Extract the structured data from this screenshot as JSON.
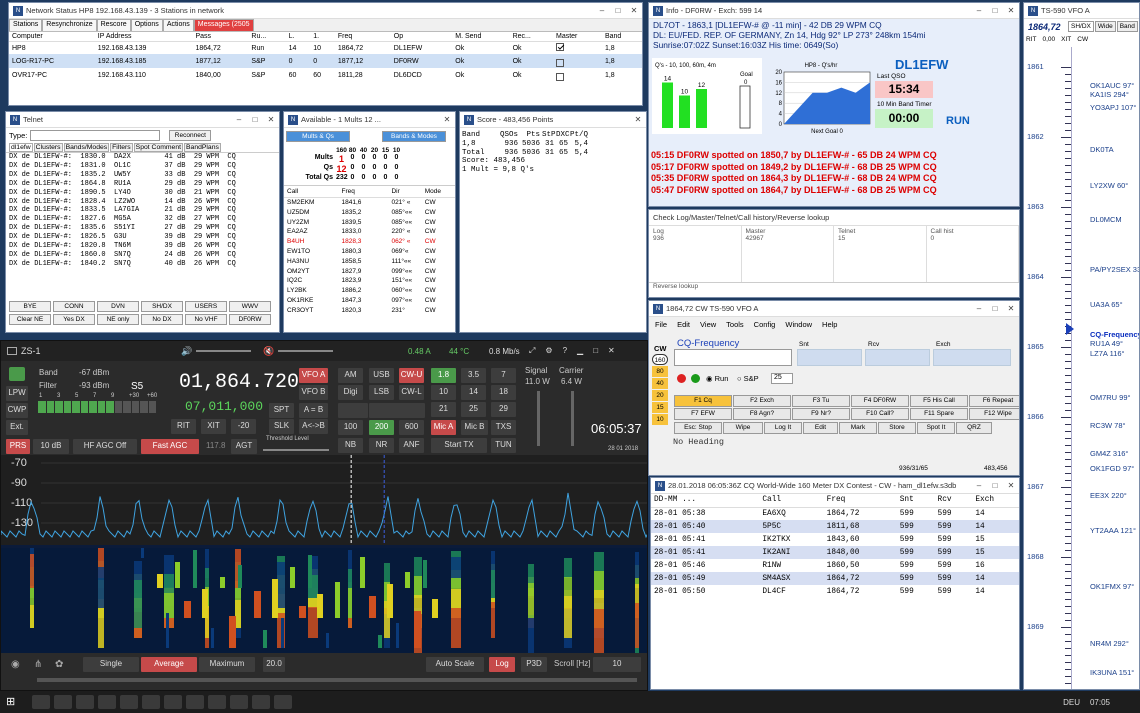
{
  "status_window": {
    "title": "Network Status HP8 192.168.43.139 - 3 Stations in network",
    "tabs": [
      "Stations",
      "Resynchronize",
      "Rescore",
      "Options",
      "Actions",
      "Messages (2505"
    ],
    "columns": [
      "Computer",
      "IP Address",
      "Pass",
      "Ru...",
      "L.",
      "1.",
      "Freq",
      "Op",
      "M. Send",
      "Rec...",
      "Master",
      "Band"
    ],
    "rows": [
      [
        "HP8",
        "192.168.43.139",
        "1864,72",
        "Run",
        "14",
        "10",
        "1864,72",
        "DL1EFW",
        "Ok",
        "Ok",
        "checked",
        "1,8"
      ],
      [
        "LOG-R17-PC",
        "192.168.43.185",
        "1877,12",
        "S&P",
        "0",
        "0",
        "1877,12",
        "DF0RW",
        "Ok",
        "Ok",
        "unchecked",
        "1,8"
      ],
      [
        "OVR17-PC",
        "192.168.43.110",
        "1840,00",
        "S&P",
        "60",
        "60",
        "1811,28",
        "DL6DCD",
        "Ok",
        "Ok",
        "unchecked",
        "1,8"
      ]
    ]
  },
  "telnet_window": {
    "title": "Telnet",
    "type_label": "Type:",
    "reconnect": "Reconnect",
    "tabs": [
      "dl1efw",
      "Clusters",
      "Bands/Modes",
      "Filters",
      "Spot Comment",
      "BandPlans"
    ],
    "lines": [
      "DX de DL1EFW-#:  1830.0  DA2X        41 dB  29 WPM  CQ",
      "DX de DL1EFW-#:  1831.0  OL1C        37 dB  29 WPM  CQ",
      "DX de DL1EFW-#:  1835.2  UW5Y        33 dB  29 WPM  CQ",
      "DX de DL1EFW-#:  1864.8  RU1A        29 dB  29 WPM  CQ",
      "DX de DL1EFW-#:  1890.5  LY4O        30 dB  21 WPM  CQ",
      "DX de DL1EFW-#:  1828.4  LZ2WO       14 dB  26 WPM  CQ",
      "DX de DL1EFW-#:  1833.5  LA7GIA      21 dB  29 WPM  CQ",
      "DX de DL1EFW-#:  1827.6  MG5A        32 dB  27 WPM  CQ",
      "DX de DL1EFW-#:  1835.6  S51YI       27 dB  29 WPM  CQ",
      "DX de DL1EFW-#:  1826.5  G3U         39 dB  29 WPM  CQ",
      "DX de DL1EFW-#:  1820.8  TN6M        39 dB  26 WPM  CQ",
      "DX de DL1EFW-#:  1860.0  SN7Q        24 dB  26 WPM  CQ",
      "DX de DL1EFW-#:  1840.2  SN7Q        40 dB  26 WPM  CQ"
    ],
    "buttons": [
      "BYE",
      "CONN",
      "DVN",
      "SH/DX",
      "USERS",
      "WWV",
      "Clear NE",
      "Yes DX",
      "NE only",
      "No DX",
      "No VHF",
      "DF0RW"
    ]
  },
  "available_window": {
    "title": "Available - 1 Mults 12 ...",
    "btn_mults": "Mults & Qs",
    "btn_bands": "Bands & Modes",
    "bands": [
      "160",
      "80",
      "40",
      "20",
      "15",
      "10"
    ],
    "mults_label": "Mults",
    "mults": [
      "1",
      "0",
      "0",
      "0",
      "0",
      "0"
    ],
    "qs_label": "Qs",
    "qs": [
      "12",
      "0",
      "0",
      "0",
      "0",
      "0"
    ],
    "totalqs_label": "Total Qs",
    "totalqs": [
      "232",
      "0",
      "0",
      "0",
      "0",
      "0"
    ],
    "cols": [
      "Call",
      "Freq",
      "Dir",
      "Mode"
    ],
    "rows": [
      [
        "SM2EKM",
        "1841,6",
        "021° «",
        "CW"
      ],
      [
        "UZ5DM",
        "1835,2",
        "085°««",
        "CW"
      ],
      [
        "UY2ZM",
        "1839,5",
        "085°««",
        "CW"
      ],
      [
        "EA2AZ",
        "1833,0",
        "220° «",
        "CW"
      ],
      [
        "B4UH",
        "1828,3",
        "062° «",
        "CW"
      ],
      [
        "EW1TO",
        "1880,3",
        "069°«",
        "CW"
      ],
      [
        "HA3NU",
        "1858,5",
        "111°««",
        "CW"
      ],
      [
        "OM2YT",
        "1827,9",
        "099°««",
        "CW"
      ],
      [
        "IQ2C",
        "1823,9",
        "151°««",
        "CW"
      ],
      [
        "LY2BK",
        "1886,2",
        "060°««",
        "CW"
      ],
      [
        "OK1RKE",
        "1847,3",
        "097°««",
        "CW"
      ],
      [
        "CR3OYT",
        "1820,3",
        "231°",
        "CW"
      ]
    ]
  },
  "score_window": {
    "title": "Score - 483,456 Points",
    "cols": [
      "Band",
      "QSOs",
      "Pts",
      "StP",
      "DXC",
      "Pt/Q"
    ],
    "rows": [
      [
        "1,8",
        "936",
        "5036",
        "31",
        "65",
        "5,4"
      ],
      [
        "Total",
        "936",
        "5036",
        "31",
        "65",
        "5,4"
      ]
    ],
    "score_line": "Score: 483,456",
    "mult_line": "1 Mult = 9,8 Q's"
  },
  "info_window": {
    "title": "Info - DF0RW - Exch: 599 14",
    "line1": "DL7OT - 1863,1 [DL1EFW-# @ -11 min] - 42 DB  29 WPM  CQ",
    "line2": "DL: EU/FED. REP. OF GERMANY, Zn 14, Hdg  92°  LP 273°  248km  154mi",
    "line3": "Sunrise:07:02Z Sunset:16:03Z His time: 0649(So)",
    "goal_title": "Q's - 10, 100, 60m, 4m",
    "goal_label": "Goal",
    "goal_value": "0",
    "bars": [
      {
        "label": "14",
        "value": 14
      },
      {
        "label": "10",
        "value": 10
      },
      {
        "label": "12",
        "value": 12
      }
    ],
    "rate_title": "HP8 - Q's/hr",
    "rate_ticks": [
      "20",
      "16",
      "12",
      "8",
      "4",
      "0"
    ],
    "rate_ymax": 20,
    "rate_values": [
      0,
      6,
      12,
      12,
      14,
      12,
      16
    ],
    "next_goal": "Next Goal 0",
    "callsign": "DL1EFW",
    "last_qso_label": "Last QSO",
    "last_qso": "15:34",
    "band_timer_label": "10 Min Band Timer",
    "band_timer": "00:00",
    "run": "RUN",
    "spots": [
      "05:15 DF0RW spotted on 1850,7 by DL1EFW-# - 65 DB  24 WPM  CQ",
      "05:17 DF0RW spotted on 1849,2 by DL1EFW-# - 68 DB  25 WPM  CQ",
      "05:35 DF0RW spotted on 1864,3 by DL1EFW-# - 68 DB  24 WPM  CQ",
      "05:47 DF0RW spotted on 1864,7 by DL1EFW-# - 68 DB  25 WPM  CQ"
    ]
  },
  "check_window": {
    "title": "Check Log/Master/Telnet/Call history/Reverse lookup",
    "cols": [
      {
        "name": "Log",
        "val": "936"
      },
      {
        "name": "Master",
        "val": "42967"
      },
      {
        "name": "Telnet",
        "val": "15"
      },
      {
        "name": "Call hist",
        "val": "0"
      }
    ],
    "reverse": "Reverse lookup"
  },
  "cq_window": {
    "title": "1864,72 CW TS-590 VFO A",
    "menu": [
      "File",
      "Edit",
      "View",
      "Tools",
      "Config",
      "Window",
      "Help"
    ],
    "cw": "CW",
    "bands": [
      "160",
      "80",
      "40",
      "20",
      "15",
      "10"
    ],
    "call_label": "CQ-Frequency",
    "snt": "Snt",
    "rcv": "Rcv",
    "exch": "Exch",
    "run": "Run",
    "sp": "S&P",
    "speed": "25",
    "fkeys": [
      "F1 Cq",
      "F2 Exch",
      "F3 Tu",
      "F4 DF0RW",
      "F5 His Call",
      "F6 Repeat",
      "F7 EFW",
      "F8 Agn?",
      "F9 Nr?",
      "F10 Call?",
      "F11 Spare",
      "F12 Wipe"
    ],
    "actions": [
      "Esc: Stop",
      "Wipe",
      "Log It",
      "Edit",
      "Mark",
      "Store",
      "Spot It",
      "QRZ"
    ],
    "heading": "No Heading",
    "status_left": "936/31/65",
    "status_right": "483,456"
  },
  "log_window": {
    "title": "28.01.2018 06:05:36Z  CQ World-Wide 160 Meter DX Contest - CW - ham_dl1efw.s3db",
    "cols": [
      "DD-MM ...",
      "Call",
      "Freq",
      "Snt",
      "Rcv",
      "Exch"
    ],
    "rows": [
      [
        "28-01 05:38",
        "EA6XQ",
        "1864,72",
        "599",
        "599",
        "14"
      ],
      [
        "28-01 05:40",
        "5P5C",
        "1811,68",
        "599",
        "599",
        "14"
      ],
      [
        "28-01 05:41",
        "IK2TKX",
        "1843,60",
        "599",
        "599",
        "15"
      ],
      [
        "28-01 05:41",
        "IK2ANI",
        "1848,00",
        "599",
        "599",
        "15"
      ],
      [
        "28-01 05:46",
        "R1NW",
        "1860,50",
        "599",
        "599",
        "16"
      ],
      [
        "28-01 05:49",
        "SM4ASX",
        "1864,72",
        "599",
        "599",
        "14"
      ],
      [
        "28-01 05:50",
        "DL4CF",
        "1864,72",
        "599",
        "599",
        "14"
      ]
    ]
  },
  "zs1": {
    "title": "ZS-1",
    "amp": "0.48 A",
    "temp": "44 °C",
    "rate": "0.8 Mb/s",
    "band_label": "Band",
    "band_val": "-67 dBm",
    "filter_label": "Filter",
    "filter_val": "-93 dBm",
    "smeter": "S5",
    "scale": [
      "1",
      "3",
      "5",
      "7",
      "9",
      "+30",
      "+60"
    ],
    "freq_main": "01,864.720",
    "freq_sub": "07,011,000",
    "btns": {
      "vfoa": "VFO A",
      "vfob": "VFO B",
      "spt": "SPT",
      "ab": "A = B",
      "rit": "RIT",
      "xit": "XIT",
      "offset": "-20",
      "slk": "SLK",
      "swap": "A<->B",
      "prs": "PRS",
      "db": "10 dB",
      "agcoff": "HF AGC Off",
      "fastagc": "Fast AGC",
      "agcval": "117.8",
      "agt": "AGT",
      "thresh": "Threshold Level",
      "lpw": "LPW",
      "cwp": "CWP",
      "ext": "Ext."
    },
    "modes": [
      "AM",
      "USB",
      "CW-U",
      "Digi",
      "LSB",
      "CW-L"
    ],
    "mode_nums": [
      "1.8",
      "3.5",
      "7",
      "10",
      "14",
      "18",
      "21",
      "25",
      "29"
    ],
    "filters": [
      "100",
      "200",
      "600",
      "Mic A",
      "Mic B",
      "TXS",
      "NB",
      "NR",
      "ANF",
      "Start TX",
      "TUN"
    ],
    "signal_label": "Signal",
    "signal_val": "11.0 W",
    "carrier_label": "Carrier",
    "carrier_val": "6.4 W",
    "clock": "06:05:37",
    "date": "28 01 2018",
    "db_ticks": [
      "-70",
      "-90",
      "-110",
      "-130"
    ],
    "freq_ticks": [
      "1860",
      "1862",
      "1864",
      "1866",
      "1868"
    ],
    "bottom": {
      "single": "Single",
      "average": "Average",
      "maximum": "Maximum",
      "val": "20.0",
      "autoscale": "Auto Scale",
      "log": "Log",
      "p3d": "P3D",
      "scroll": "Scroll [Hz]",
      "scroll_val": "10"
    }
  },
  "ts590": {
    "title": "TS-590 VFO A",
    "freq": "1864,72",
    "tabs": [
      "SH/DX",
      "Wide",
      "Band"
    ],
    "rit": "RIT",
    "rit_val": "0,00",
    "xit": "XIT",
    "cw": "CW",
    "mhz_labels": [
      "1861",
      "1862",
      "1863",
      "1864",
      "1865",
      "1866",
      "1867",
      "1868",
      "1869"
    ],
    "spots": [
      "OK1AUC 97°",
      "KA1IS 294°",
      "YO3APJ 107°",
      "DK0TA",
      "LY2XW 60°",
      "DL0MCM",
      "PA/PY2SEX 332°",
      "UA3A 65°",
      "CQ-Frequency",
      "RU1A 49°",
      "LZ7A 116°",
      "OM7RU 99°",
      "RC3W 78°",
      "GM4Z 316°",
      "OK1FGD 97°",
      "EE3X 220°",
      "YT2AAA 121°",
      "OK1FMX 97°",
      "NR4M 292°",
      "IK3UNA 151°"
    ]
  },
  "taskbar": {
    "lang": "DEU",
    "time": "07:05"
  }
}
